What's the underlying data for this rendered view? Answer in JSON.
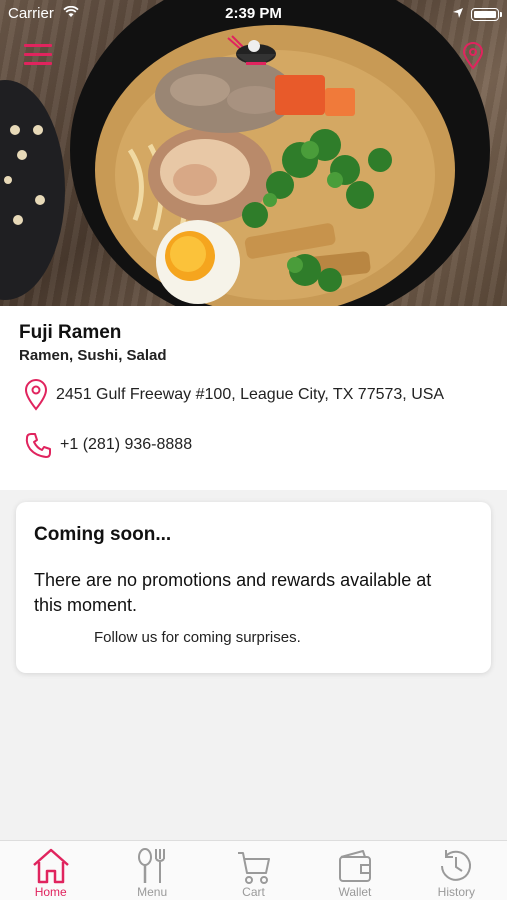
{
  "status_bar": {
    "carrier": "Carrier",
    "time": "2:39 PM"
  },
  "restaurant": {
    "name": "Fuji Ramen",
    "categories": "Ramen, Sushi, Salad",
    "address": "2451 Gulf Freeway #100, League City, TX 77573, USA",
    "phone": "+1 (281) 936-8888"
  },
  "promo": {
    "title": "Coming soon...",
    "message": "There are no promotions and rewards available at this moment.",
    "follow": "Follow us for coming surprises."
  },
  "tabs": [
    {
      "label": "Home",
      "icon": "home-icon",
      "active": true
    },
    {
      "label": "Menu",
      "icon": "fork-knife-icon",
      "active": false
    },
    {
      "label": "Cart",
      "icon": "cart-icon",
      "active": false
    },
    {
      "label": "Wallet",
      "icon": "wallet-icon",
      "active": false
    },
    {
      "label": "History",
      "icon": "history-icon",
      "active": false
    }
  ],
  "colors": {
    "accent": "#e0245e",
    "inactive": "#9a9a9a",
    "background": "#f2f2f2"
  }
}
